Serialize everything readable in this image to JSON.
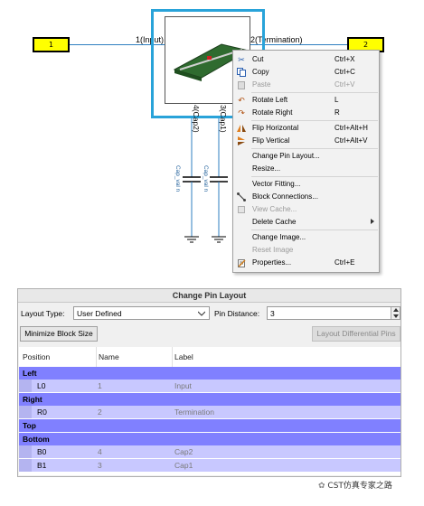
{
  "schematic": {
    "port_left": "1",
    "port_right": "2",
    "pin_input": "1(Input)",
    "pin_termination": "2(Termination)",
    "pin_cap2": "4(Cap2)",
    "pin_cap1": "3(Cap1)",
    "cap_label_1": "Cap_val n",
    "cap_label_2": "Cap_val n"
  },
  "context_menu": {
    "items": [
      {
        "label": "Cut",
        "shortcut": "Ctrl+X",
        "icon": "scissors-icon",
        "enabled": true
      },
      {
        "label": "Copy",
        "shortcut": "Ctrl+C",
        "icon": "copy-icon",
        "enabled": true
      },
      {
        "label": "Paste",
        "shortcut": "Ctrl+V",
        "icon": "paste-icon",
        "enabled": false
      },
      {
        "label": "Rotate Left",
        "shortcut": "L",
        "icon": "rotate-left-icon",
        "enabled": true
      },
      {
        "label": "Rotate Right",
        "shortcut": "R",
        "icon": "rotate-right-icon",
        "enabled": true
      },
      {
        "label": "Flip Horizontal",
        "shortcut": "Ctrl+Alt+H",
        "icon": "flip-horizontal-icon",
        "enabled": true
      },
      {
        "label": "Flip Vertical",
        "shortcut": "Ctrl+Alt+V",
        "icon": "flip-vertical-icon",
        "enabled": true
      },
      {
        "label": "Change Pin Layout...",
        "shortcut": "",
        "icon": "",
        "enabled": true
      },
      {
        "label": "Resize...",
        "shortcut": "",
        "icon": "",
        "enabled": true
      },
      {
        "label": "Vector Fitting...",
        "shortcut": "",
        "icon": "",
        "enabled": true
      },
      {
        "label": "Block Connections...",
        "shortcut": "",
        "icon": "block-connections-icon",
        "enabled": true
      },
      {
        "label": "View Cache...",
        "shortcut": "",
        "icon": "view-cache-icon",
        "enabled": false
      },
      {
        "label": "Delete Cache",
        "shortcut": "",
        "icon": "",
        "enabled": true
      },
      {
        "label": "Change Image...",
        "shortcut": "",
        "icon": "",
        "enabled": true
      },
      {
        "label": "Reset Image",
        "shortcut": "",
        "icon": "",
        "enabled": false
      },
      {
        "label": "Properties...",
        "shortcut": "Ctrl+E",
        "icon": "properties-icon",
        "enabled": true
      }
    ]
  },
  "dialog": {
    "title": "Change Pin Layout",
    "layout_type_label": "Layout Type:",
    "layout_type_value": "User Defined",
    "pin_distance_label": "Pin Distance:",
    "pin_distance_value": "3",
    "minimize_button": "Minimize Block Size",
    "differential_button": "Layout Differential Pins",
    "columns": [
      "Position",
      "Name",
      "Label"
    ],
    "groups": {
      "left": "Left",
      "right": "Right",
      "top": "Top",
      "bottom": "Bottom"
    },
    "rows": {
      "l0": {
        "position": "L0",
        "name": "1",
        "label": "Input"
      },
      "r0": {
        "position": "R0",
        "name": "2",
        "label": "Termination"
      },
      "b0": {
        "position": "B0",
        "name": "4",
        "label": "Cap2"
      },
      "b1": {
        "position": "B1",
        "name": "3",
        "label": "Cap1"
      }
    }
  },
  "watermark": "CST仿真专家之路"
}
